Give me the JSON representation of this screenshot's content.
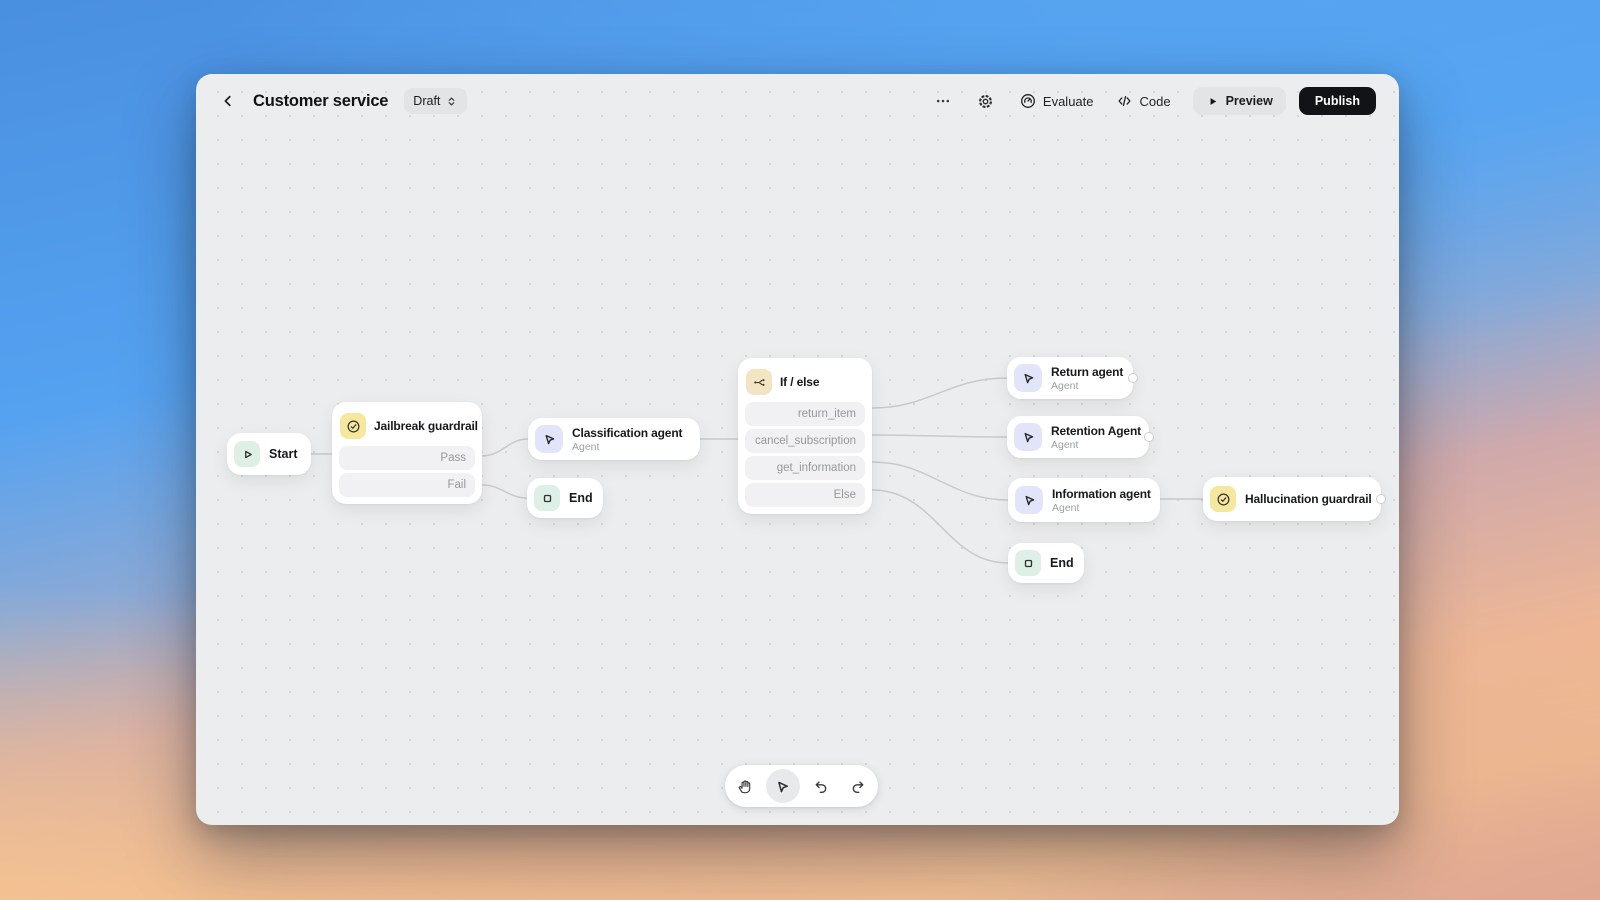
{
  "header": {
    "title": "Customer service",
    "status_label": "Draft",
    "evaluate_label": "Evaluate",
    "code_label": "Code",
    "preview_label": "Preview",
    "publish_label": "Publish"
  },
  "canvas": {
    "nodes": [
      {
        "id": "start",
        "type": "start",
        "title": "Start"
      },
      {
        "id": "jailbreak-guardrail",
        "type": "guardrail",
        "title": "Jailbreak guardrail",
        "branches": [
          "Pass",
          "Fail"
        ]
      },
      {
        "id": "classification-agent",
        "type": "agent",
        "title": "Classification agent",
        "subtitle": "Agent"
      },
      {
        "id": "end-1",
        "type": "end",
        "title": "End"
      },
      {
        "id": "if-else",
        "type": "logic",
        "title": "If / else",
        "branches": [
          "return_item",
          "cancel_subscription",
          "get_information",
          "Else"
        ]
      },
      {
        "id": "return-agent",
        "type": "agent",
        "title": "Return agent",
        "subtitle": "Agent"
      },
      {
        "id": "retention-agent",
        "type": "agent",
        "title": "Retention Agent",
        "subtitle": "Agent"
      },
      {
        "id": "information-agent",
        "type": "agent",
        "title": "Information agent",
        "subtitle": "Agent"
      },
      {
        "id": "hallucination-guardrail",
        "type": "guardrail",
        "title": "Hallucination guardrail"
      },
      {
        "id": "end-2",
        "type": "end",
        "title": "End"
      }
    ],
    "edges": [
      {
        "from": "start",
        "to": "jailbreak-guardrail"
      },
      {
        "from": "jailbreak-guardrail.Pass",
        "to": "classification-agent"
      },
      {
        "from": "jailbreak-guardrail.Fail",
        "to": "end-1"
      },
      {
        "from": "classification-agent",
        "to": "if-else"
      },
      {
        "from": "if-else.return_item",
        "to": "return-agent"
      },
      {
        "from": "if-else.cancel_subscription",
        "to": "retention-agent"
      },
      {
        "from": "if-else.get_information",
        "to": "information-agent"
      },
      {
        "from": "if-else.Else",
        "to": "end-2"
      },
      {
        "from": "information-agent",
        "to": "hallucination-guardrail"
      }
    ],
    "toolbar": {
      "tools": [
        "pan",
        "select",
        "undo",
        "redo"
      ],
      "active_tool": "select"
    }
  },
  "colors": {
    "canvas_bg": "#ecedee",
    "dot_grid": "#d4d6d7",
    "edge": "#c8cacb",
    "publish_bg": "#111316",
    "gray_button_bg": "#e2e4e6",
    "start_end_icon_bg": "#def0e6",
    "agent_icon_bg": "#e2e5fa",
    "guardrail_icon_bg": "#f6e79f",
    "logic_icon_bg": "#f3e5c3"
  }
}
